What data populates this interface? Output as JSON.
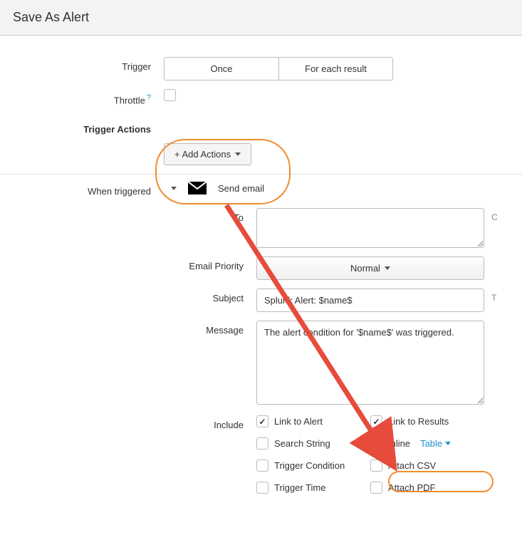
{
  "header": {
    "title": "Save As Alert"
  },
  "trigger": {
    "label": "Trigger",
    "opt_once": "Once",
    "opt_each": "For each result"
  },
  "throttle": {
    "label": "Throttle",
    "help": "?"
  },
  "trigger_actions": {
    "section_label": "Trigger Actions",
    "add_button": "+ Add Actions",
    "when_triggered_label": "When triggered",
    "send_email_title": "Send email"
  },
  "email": {
    "to_label": "To",
    "to_value": "",
    "hint_to": "C",
    "priority_label": "Email Priority",
    "priority_value": "Normal",
    "subject_label": "Subject",
    "subject_value": "Splunk Alert: $name$",
    "hint_subject": "T",
    "message_label": "Message",
    "message_value": "The alert condition for '$name$' was triggered.",
    "include_label": "Include",
    "include": {
      "link_to_alert": "Link to Alert",
      "link_to_results": "Link to Results",
      "search_string": "Search String",
      "inline": "Inline",
      "inline_select": "Table",
      "trigger_condition": "Trigger Condition",
      "attach_csv": "Attach CSV",
      "trigger_time": "Trigger Time",
      "attach_pdf": "Attach PDF"
    }
  }
}
